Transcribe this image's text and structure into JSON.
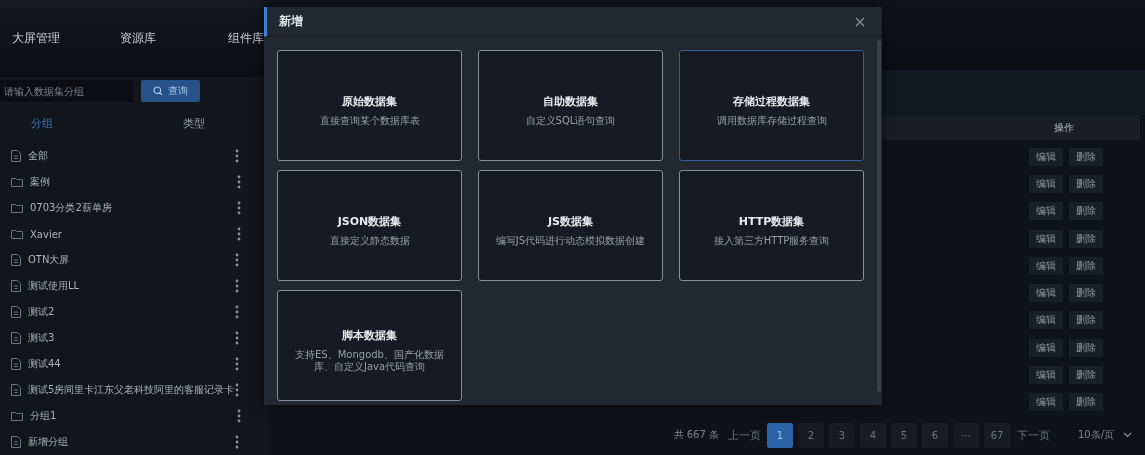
{
  "nav": [
    {
      "label": "大屏管理"
    },
    {
      "label": "资源库"
    },
    {
      "label": "组件库"
    }
  ],
  "search": {
    "placeholder": "请输入数据集分组",
    "button": "查询"
  },
  "side_tabs": [
    {
      "label": "分组",
      "selected": true
    },
    {
      "label": "类型",
      "selected": false
    }
  ],
  "groups": [
    {
      "name": "全部",
      "kind": "file"
    },
    {
      "name": "案例",
      "kind": "folder"
    },
    {
      "name": "0703分类2薪单房",
      "kind": "folder"
    },
    {
      "name": "Xavier",
      "kind": "folder"
    },
    {
      "name": "OTN大屏",
      "kind": "file"
    },
    {
      "name": "测试使用LL",
      "kind": "file"
    },
    {
      "name": "测试2",
      "kind": "file"
    },
    {
      "name": "测试3",
      "kind": "file"
    },
    {
      "name": "测试44",
      "kind": "file"
    },
    {
      "name": "测试5房间里卡江东父老科技阿里的客服记录卡",
      "kind": "file"
    },
    {
      "name": "分组1",
      "kind": "folder"
    },
    {
      "name": "新增分组",
      "kind": "file"
    }
  ],
  "table": {
    "columns": [
      "操作"
    ],
    "rows": [
      {
        "actions": [
          "编辑",
          "删除"
        ]
      },
      {
        "actions": [
          "编辑",
          "删除"
        ]
      },
      {
        "actions": [
          "编辑",
          "删除"
        ]
      },
      {
        "actions": [
          "编辑",
          "删除"
        ]
      },
      {
        "actions": [
          "编辑",
          "删除"
        ]
      },
      {
        "actions": [
          "编辑",
          "删除"
        ]
      },
      {
        "actions": [
          "编辑",
          "删除"
        ]
      },
      {
        "actions": [
          "编辑",
          "删除"
        ]
      },
      {
        "actions": [
          "编辑",
          "删除"
        ]
      },
      {
        "actions": [
          "编辑",
          "删除"
        ]
      }
    ]
  },
  "pagination": {
    "total": "共 667 条",
    "prev": "上一页",
    "pages": [
      {
        "label": "1",
        "selected": true
      },
      {
        "label": "2",
        "selected": false
      },
      {
        "label": "3",
        "selected": false
      },
      {
        "label": "4",
        "selected": false
      },
      {
        "label": "5",
        "selected": false
      },
      {
        "label": "6",
        "selected": false
      },
      {
        "label": "···",
        "selected": false
      },
      {
        "label": "67",
        "selected": false
      }
    ],
    "next": "下一页",
    "page_size": "10条/页"
  },
  "dialog": {
    "title": "新增",
    "cards": [
      {
        "title": "原始数据集",
        "description": "直接查询某个数据库表",
        "selected": false
      },
      {
        "title": "自助数据集",
        "description": "自定义SQL语句查询",
        "selected": false
      },
      {
        "title": "存储过程数据集",
        "description": "调用数据库存储过程查询",
        "selected": true
      },
      {
        "title": "JSON数据集",
        "description": "直接定义静态数据",
        "selected": false
      },
      {
        "title": "JS数据集",
        "description": "编写JS代码进行动态模拟数据创建",
        "selected": false
      },
      {
        "title": "HTTP数据集",
        "description": "接入第三方HTTP服务查询",
        "selected": false
      },
      {
        "title": "脚本数据集",
        "description": "支持ES、Mongodb、国产化数据库、自定义Java代码查询",
        "selected": false
      }
    ]
  }
}
